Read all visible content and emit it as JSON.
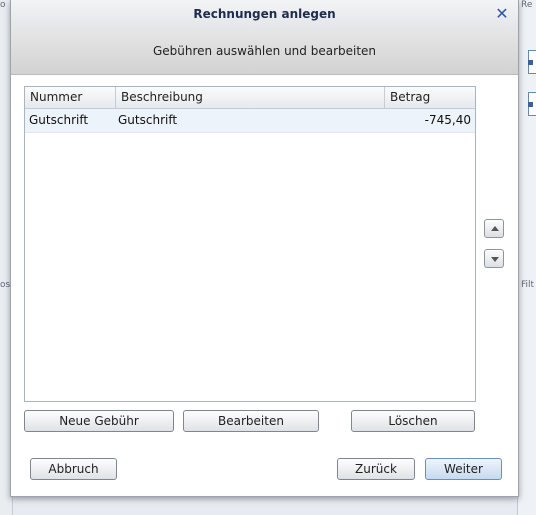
{
  "dialog": {
    "title": "Rechnungen anlegen",
    "subtitle": "Gebühren auswählen und bearbeiten"
  },
  "table": {
    "columns": [
      "Nummer",
      "Beschreibung",
      "Betrag"
    ],
    "rows": [
      {
        "nummer": "Gutschrift",
        "beschreibung": "Gutschrift",
        "betrag": "-745,40"
      }
    ]
  },
  "actions": {
    "new_fee": "Neue Gebühr",
    "edit": "Bearbeiten",
    "delete": "Löschen"
  },
  "footer": {
    "cancel": "Abbruch",
    "back": "Zurück",
    "next": "Weiter"
  },
  "background": {
    "right_fragment_top": "Re",
    "right_fragment_mid": "Filt",
    "left_fragment_top": "o",
    "left_fragment_mid": "os"
  },
  "colors": {
    "accent": "#2c5aa8",
    "row_selected": "#edf3fa"
  },
  "icons": {
    "close": "close-icon",
    "move_up": "triangle-up-icon",
    "move_down": "triangle-down-icon"
  }
}
